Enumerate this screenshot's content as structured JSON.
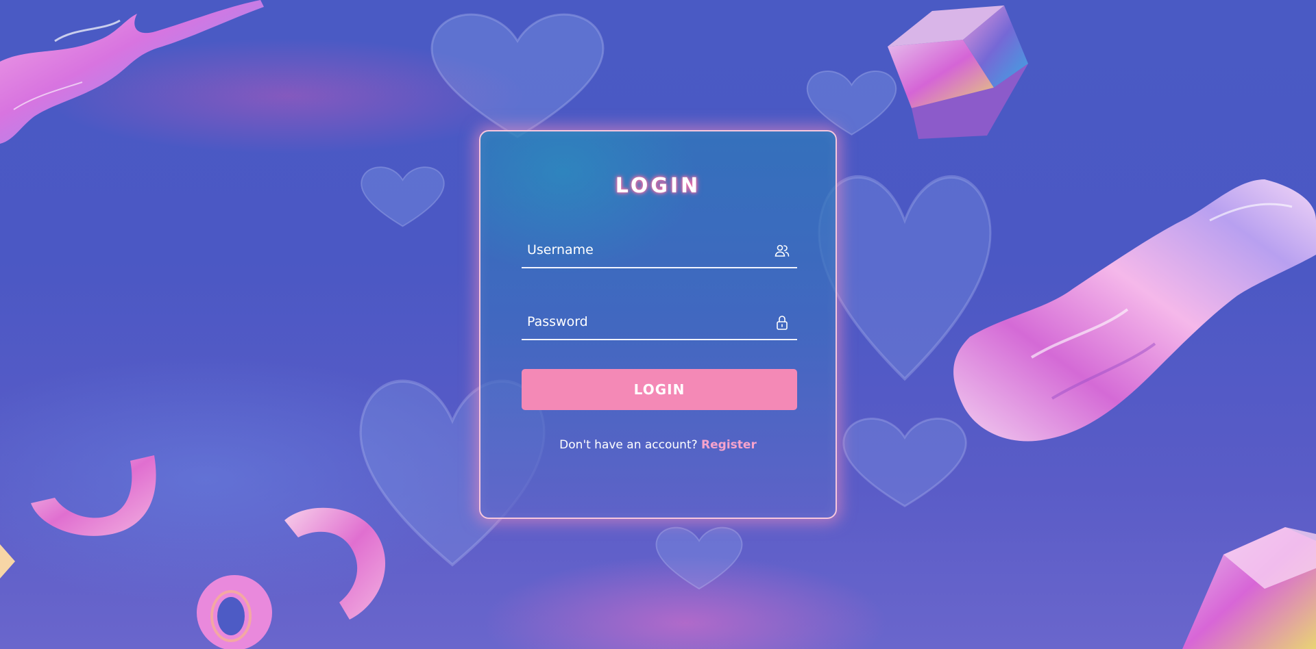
{
  "login_form": {
    "title": "LOGIN",
    "username": {
      "placeholder": "Username",
      "icon": "users-icon"
    },
    "password": {
      "placeholder": "Password",
      "icon": "lock-icon"
    },
    "submit_label": "LOGIN",
    "register_prompt": "Don't have an account?",
    "register_link": "Register"
  },
  "colors": {
    "accent": "#f489b6",
    "link": "#f7a3cc",
    "background": "#4b58c4"
  }
}
